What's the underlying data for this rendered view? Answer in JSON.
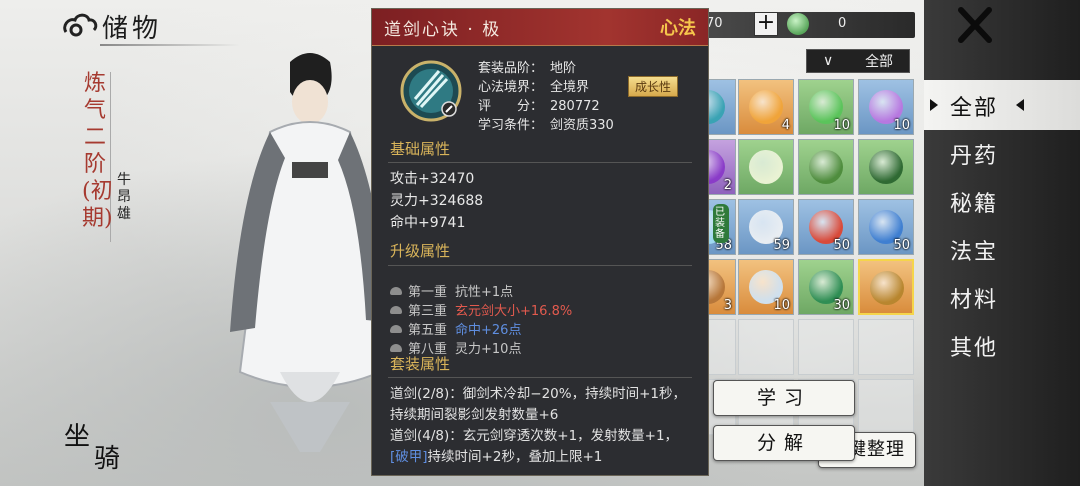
{
  "header": {
    "title": "储物"
  },
  "character": {
    "realm": "炼气二阶(初期)",
    "name": "牛昂雄"
  },
  "mount_button": {
    "char1": "坐",
    "char2": "骑"
  },
  "tooltip": {
    "name": "道剑心诀 · 极",
    "type": "心法",
    "info": [
      {
        "key": "套装品阶：",
        "value": "地阶"
      },
      {
        "key": "心法境界：",
        "value": "全境界"
      },
      {
        "key": "评　　分：",
        "value": "280772"
      },
      {
        "key": "学习条件：",
        "value": "剑资质330"
      }
    ],
    "growth_tag": "成长性",
    "base_title": "基础属性",
    "base_stats": [
      "攻击+32470",
      "灵力+324688",
      "命中+9741"
    ],
    "upgrade_title": "升级属性",
    "upgrades": [
      {
        "level": "第一重",
        "text": "抗性+1点",
        "color": "#c7c7c7"
      },
      {
        "level": "第三重",
        "text": "玄元剑大小+16.8%",
        "color": "#e25a4e"
      },
      {
        "level": "第五重",
        "text": "命中+26点",
        "color": "#5f8ee0"
      },
      {
        "level": "第八重",
        "text": "灵力+10点",
        "color": "#c7c7c7"
      }
    ],
    "set_title": "套装属性",
    "set_line1": "道剑(2/8)：御剑术冷却−20%，持续时间+1秒，持续期间裂影剑发射数量+6",
    "set_line2a": "道剑(4/8)：玄元剑穿透次数+1，发射数量+1，",
    "set_tag": "[破甲]",
    "set_line2b": "持续时间+2秒，叠加上限+1"
  },
  "topbar": {
    "currency1": "70",
    "plus": "+",
    "currency2": "0",
    "filter_label": "全部"
  },
  "grid": {
    "counts": [
      "",
      "4",
      "10",
      "10",
      "2",
      "",
      "",
      "",
      "58",
      "59",
      "50",
      "50",
      "3",
      "10",
      "30",
      "",
      "",
      "",
      "",
      "",
      "",
      "",
      "",
      ""
    ],
    "equipped_label": "已装备"
  },
  "categories": [
    "全部",
    "丹药",
    "秘籍",
    "法宝",
    "材料",
    "其他"
  ],
  "actions": {
    "learn": "学习",
    "decompose": "分解",
    "sort": "一键整理"
  },
  "colors": {
    "accent_red": "#a2342f",
    "gold": "#d9b45a",
    "panel_bg": "#2c2d31"
  }
}
